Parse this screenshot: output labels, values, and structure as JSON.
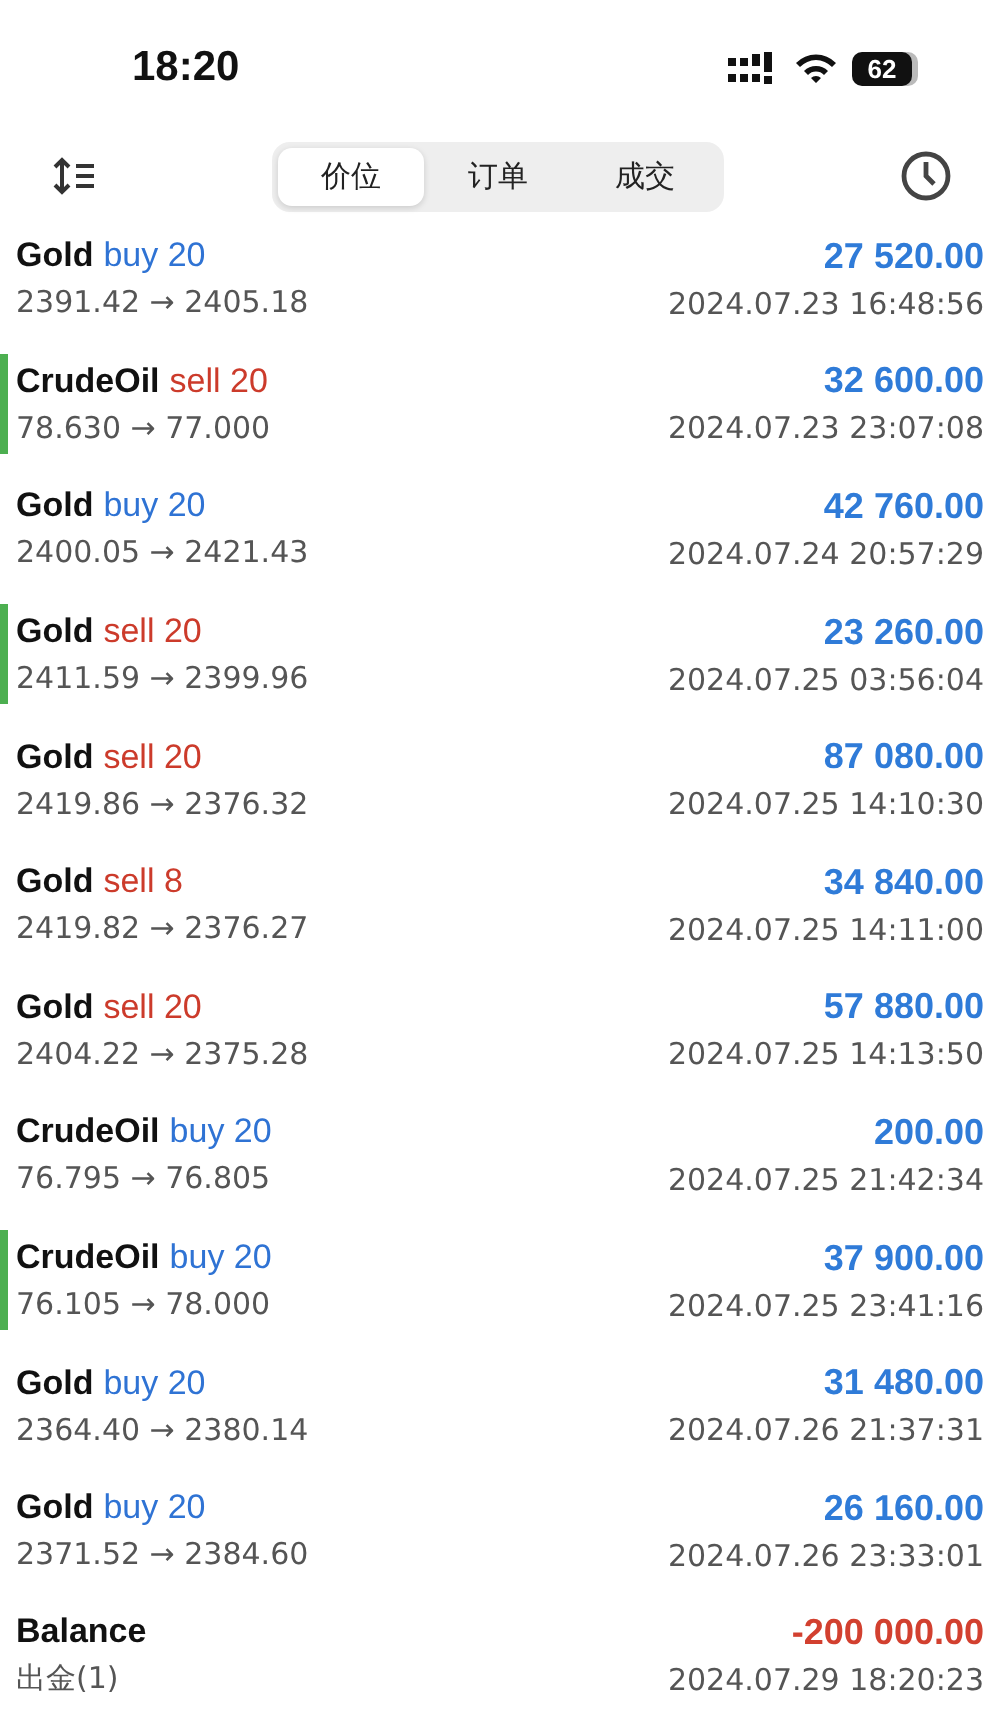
{
  "status_bar": {
    "time": "18:20",
    "battery": "62"
  },
  "toolbar": {
    "tabs": [
      {
        "label": "价位",
        "selected": true
      },
      {
        "label": "订单",
        "selected": false
      },
      {
        "label": "成交",
        "selected": false
      }
    ]
  },
  "deals": [
    {
      "kind": "buy",
      "symbol": "Gold",
      "side": "buy 20",
      "prices": "2391.42 → 2405.18",
      "amount": "27 520.00",
      "loss": false,
      "time": "2024.07.23 16:48:56",
      "marked": false
    },
    {
      "kind": "sell",
      "symbol": "CrudeOil",
      "side": "sell 20",
      "prices": "78.630 → 77.000",
      "amount": "32 600.00",
      "loss": false,
      "time": "2024.07.23 23:07:08",
      "marked": true
    },
    {
      "kind": "buy",
      "symbol": "Gold",
      "side": "buy 20",
      "prices": "2400.05 → 2421.43",
      "amount": "42 760.00",
      "loss": false,
      "time": "2024.07.24 20:57:29",
      "marked": false
    },
    {
      "kind": "sell",
      "symbol": "Gold",
      "side": "sell 20",
      "prices": "2411.59 → 2399.96",
      "amount": "23 260.00",
      "loss": false,
      "time": "2024.07.25 03:56:04",
      "marked": true
    },
    {
      "kind": "sell",
      "symbol": "Gold",
      "side": "sell 20",
      "prices": "2419.86 → 2376.32",
      "amount": "87 080.00",
      "loss": false,
      "time": "2024.07.25 14:10:30",
      "marked": false
    },
    {
      "kind": "sell",
      "symbol": "Gold",
      "side": "sell 8",
      "prices": "2419.82 → 2376.27",
      "amount": "34 840.00",
      "loss": false,
      "time": "2024.07.25 14:11:00",
      "marked": false
    },
    {
      "kind": "sell",
      "symbol": "Gold",
      "side": "sell 20",
      "prices": "2404.22 → 2375.28",
      "amount": "57 880.00",
      "loss": false,
      "time": "2024.07.25 14:13:50",
      "marked": false
    },
    {
      "kind": "buy",
      "symbol": "CrudeOil",
      "side": "buy 20",
      "prices": "76.795 → 76.805",
      "amount": "200.00",
      "loss": false,
      "time": "2024.07.25 21:42:34",
      "marked": false
    },
    {
      "kind": "buy",
      "symbol": "CrudeOil",
      "side": "buy 20",
      "prices": "76.105 → 78.000",
      "amount": "37 900.00",
      "loss": false,
      "time": "2024.07.25 23:41:16",
      "marked": true
    },
    {
      "kind": "buy",
      "symbol": "Gold",
      "side": "buy 20",
      "prices": "2364.40 → 2380.14",
      "amount": "31 480.00",
      "loss": false,
      "time": "2024.07.26 21:37:31",
      "marked": false
    },
    {
      "kind": "buy",
      "symbol": "Gold",
      "side": "buy 20",
      "prices": "2371.52 → 2384.60",
      "amount": "26 160.00",
      "loss": false,
      "time": "2024.07.26 23:33:01",
      "marked": false
    },
    {
      "kind": "balance",
      "symbol": "Balance",
      "prices": "出金(1)",
      "amount": "-200 000.00",
      "loss": true,
      "time": "2024.07.29 18:20:23",
      "marked": false
    }
  ]
}
